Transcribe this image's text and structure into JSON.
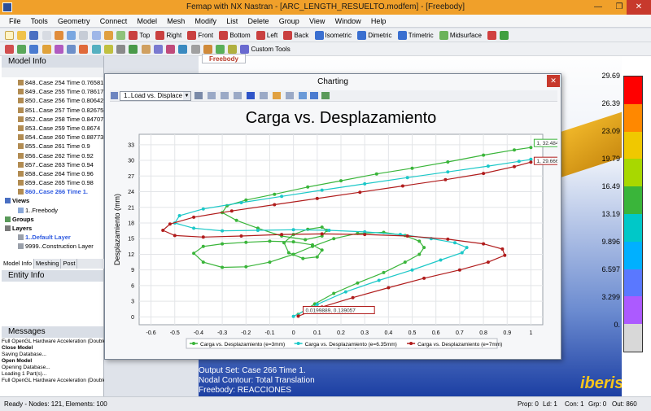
{
  "window": {
    "title": "Femap with NX Nastran - [ARC_LENGTH_RESUELTO.modfem] - [Freebody]",
    "min": "—",
    "max": "❐",
    "close": "✕"
  },
  "menu": [
    "File",
    "Tools",
    "Geometry",
    "Connect",
    "Model",
    "Mesh",
    "Modify",
    "List",
    "Delete",
    "Group",
    "View",
    "Window",
    "Help"
  ],
  "toolbar1_labels": [
    "Top",
    "Right",
    "Front",
    "Bottom",
    "Left",
    "Back",
    "Isometric",
    "Dimetric",
    "Trimetric",
    "Midsurface"
  ],
  "toolbar2_labels": [
    "Custom Tools"
  ],
  "panels": {
    "model_info": "Model Info",
    "entity_info": "Entity Info",
    "messages": "Messages"
  },
  "tree": [
    "848..Case 254 Time 0.76581",
    "849..Case 255 Time 0.78617",
    "850..Case 256 Time 0.80642",
    "851..Case 257 Time 0.82675",
    "852..Case 258 Time 0.84707",
    "853..Case 259 Time 0.8674",
    "854..Case 260 Time 0.88773",
    "855..Case 261 Time 0.9",
    "856..Case 262 Time 0.92",
    "857..Case 263 Time 0.94",
    "858..Case 264 Time 0.96",
    "859..Case 265 Time 0.98",
    "860..Case 266 Time 1.",
    "Views",
    "1..Freebody",
    "Groups",
    "Layers",
    "1..Default Layer",
    "9999..Construction Layer"
  ],
  "tabs": [
    "Model Info",
    "Meshing",
    "Post"
  ],
  "messages": [
    "Full OpenGL Hardware Acceleration (Double",
    "Close Model",
    "Saving Database...",
    "Open Model",
    "Opening Database...",
    "Loading 1 Part(s)...",
    "Full OpenGL Hardware Acceleration (Double Buffered)"
  ],
  "view": {
    "tab": "Freebody",
    "output_lines": [
      "Output Set: Case 266 Time 1.",
      "Nodal Contour: Total Translation",
      "Freebody: REACCIONES"
    ],
    "brand": "iberisa"
  },
  "legend": {
    "values": [
      "29.69",
      "26.39",
      "23.09",
      "19.79",
      "16.49",
      "13.19",
      "9.896",
      "6.597",
      "3.299",
      "0."
    ],
    "colors": [
      "#ff0000",
      "#ff8800",
      "#f0c800",
      "#a8d800",
      "#3ab53a",
      "#00c8c8",
      "#00b0ff",
      "#5a78ff",
      "#ac5aff",
      "#d8d8d8"
    ]
  },
  "status": {
    "left": "Ready - Nodes: 121,  Elements: 100",
    "items": [
      "Prop: 0",
      "Ld: 1",
      "Con: 1",
      "Grp: 0",
      "Out: 860"
    ]
  },
  "charting": {
    "window_title": "Charting",
    "selector": "1..Load vs. Displace",
    "close": "✕"
  },
  "chart_data": {
    "type": "scatter",
    "title": "Carga vs. Desplazamiento",
    "xlabel": "Carga (N)",
    "ylabel": "Desplazamiento (mm)",
    "xlim": [
      -0.65,
      1.05
    ],
    "ylim": [
      -1.5,
      35
    ],
    "xticks": [
      -0.6,
      -0.5,
      -0.4,
      -0.3,
      -0.2,
      -0.1,
      0,
      0.1,
      0.2,
      0.3,
      0.4,
      0.5,
      0.6,
      0.7,
      0.8,
      0.9,
      1
    ],
    "yticks": [
      0,
      3,
      6,
      9,
      12,
      15,
      18,
      21,
      24,
      27,
      30,
      33
    ],
    "grid": true,
    "legend_position": "bottom",
    "annotations": [
      "1, 32.4846",
      "1, 29.6665",
      "0.0199889, 0.139057"
    ],
    "series": [
      {
        "name": "Carga vs. Desplazamiento (e=3mm)",
        "color": "#3ab53a",
        "x": [
          0.02,
          0.09,
          0.17,
          0.27,
          0.38,
          0.47,
          0.53,
          0.55,
          0.53,
          0.47,
          0.38,
          0.27,
          0.17,
          0.08,
          0.0,
          -0.1,
          -0.2,
          -0.3,
          -0.38,
          -0.42,
          -0.38,
          -0.3,
          -0.2,
          -0.1,
          0.0,
          0.08,
          0.12,
          0.1,
          0.04,
          -0.02,
          -0.04,
          0.0,
          0.06,
          0.12,
          0.14,
          0.12,
          0.05,
          -0.05,
          -0.15,
          -0.24,
          -0.3,
          -0.28,
          -0.2,
          -0.08,
          0.06,
          0.2,
          0.35,
          0.5,
          0.65,
          0.8,
          0.93,
          1.0
        ],
        "y": [
          0.5,
          2.5,
          4.5,
          6.5,
          8.5,
          10.5,
          12.0,
          13.3,
          14.5,
          15.6,
          16.2,
          16.0,
          15.0,
          13.5,
          12.0,
          10.5,
          9.6,
          9.5,
          10.5,
          12.2,
          13.5,
          14.0,
          14.3,
          14.5,
          14.4,
          13.8,
          12.8,
          11.5,
          11.2,
          12.3,
          14.2,
          15.8,
          16.8,
          17.2,
          16.6,
          15.5,
          14.8,
          15.5,
          17.0,
          18.5,
          20.0,
          21.3,
          22.4,
          23.5,
          24.9,
          26.1,
          27.4,
          28.5,
          29.7,
          31.0,
          32.0,
          32.48
        ]
      },
      {
        "name": "Carga vs. Desplazamiento (e=6.35mm)",
        "color": "#1cc8c8",
        "x": [
          0.0,
          0.1,
          0.22,
          0.36,
          0.5,
          0.62,
          0.71,
          0.73,
          0.68,
          0.58,
          0.45,
          0.3,
          0.15,
          0.0,
          -0.15,
          -0.3,
          -0.42,
          -0.5,
          -0.48,
          -0.38,
          -0.22,
          -0.05,
          0.12,
          0.3,
          0.48,
          0.65,
          0.82,
          0.95,
          1.0
        ],
        "y": [
          0.1,
          2.4,
          4.8,
          7.0,
          9.0,
          10.9,
          12.3,
          13.3,
          14.2,
          15.0,
          15.8,
          16.3,
          16.6,
          16.7,
          16.6,
          16.5,
          17.0,
          18.0,
          19.4,
          20.7,
          21.9,
          23.1,
          24.3,
          25.5,
          26.7,
          27.8,
          28.9,
          29.8,
          30.2
        ]
      },
      {
        "name": "Carga vs. Desplazamiento (e=7mm)",
        "color": "#b01c1c",
        "x": [
          0.02,
          0.12,
          0.25,
          0.4,
          0.55,
          0.7,
          0.82,
          0.89,
          0.88,
          0.8,
          0.65,
          0.48,
          0.3,
          0.12,
          -0.05,
          -0.22,
          -0.38,
          -0.5,
          -0.55,
          -0.52,
          -0.42,
          -0.26,
          -0.08,
          0.1,
          0.28,
          0.46,
          0.64,
          0.8,
          0.93,
          1.0
        ],
        "y": [
          0.14,
          1.9,
          3.7,
          5.6,
          7.4,
          9.0,
          10.5,
          11.8,
          13.0,
          14.0,
          14.9,
          15.5,
          15.8,
          15.9,
          15.8,
          15.5,
          15.3,
          15.6,
          16.6,
          17.8,
          19.1,
          20.3,
          21.5,
          22.7,
          23.9,
          25.1,
          26.3,
          27.5,
          28.8,
          29.67
        ]
      }
    ]
  }
}
